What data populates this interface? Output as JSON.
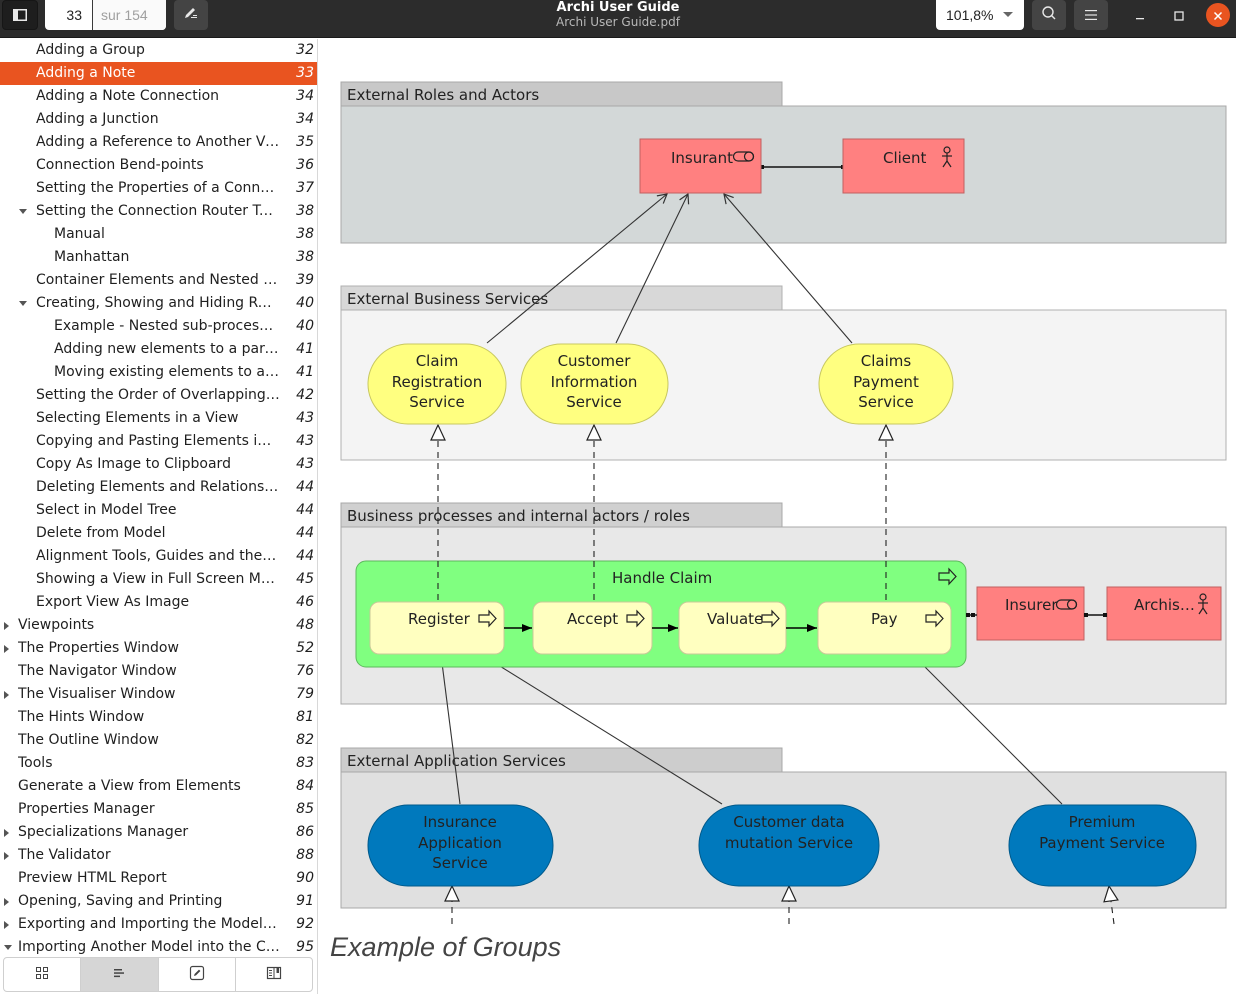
{
  "header": {
    "title": "Archi User Guide",
    "subtitle": "Archi User Guide.pdf",
    "current_page": "33",
    "total_pages": "sur 154",
    "zoom_level": "101,8%",
    "icons": {
      "sidebar_toggle": "sidebar-toggle-icon",
      "annotate": "pencil-icon",
      "search": "search-icon",
      "menu": "hamburger-menu-icon",
      "minimize": "minimize-icon",
      "maximize": "maximize-icon",
      "close": "close-icon"
    }
  },
  "sidebar": {
    "toc": [
      {
        "label": "Adding a Group",
        "page": "32",
        "level": 1,
        "expander": "none",
        "selected": false
      },
      {
        "label": "Adding a Note",
        "page": "33",
        "level": 1,
        "expander": "none",
        "selected": true
      },
      {
        "label": "Adding a Note Connection",
        "page": "34",
        "level": 1,
        "expander": "none",
        "selected": false
      },
      {
        "label": "Adding a Junction",
        "page": "34",
        "level": 1,
        "expander": "none",
        "selected": false
      },
      {
        "label": "Adding a Reference to Another View",
        "page": "35",
        "level": 1,
        "expander": "none",
        "selected": false
      },
      {
        "label": "Connection Bend-points",
        "page": "36",
        "level": 1,
        "expander": "none",
        "selected": false
      },
      {
        "label": "Setting the Properties of a Connec…",
        "page": "37",
        "level": 1,
        "expander": "none",
        "selected": false
      },
      {
        "label": "Setting the Connection Router Typ…",
        "page": "38",
        "level": 1,
        "expander": "open",
        "selected": false
      },
      {
        "label": "Manual",
        "page": "38",
        "level": 2,
        "expander": "none",
        "selected": false
      },
      {
        "label": "Manhattan",
        "page": "38",
        "level": 2,
        "expander": "none",
        "selected": false
      },
      {
        "label": "Container Elements and Nested El…",
        "page": "39",
        "level": 1,
        "expander": "none",
        "selected": false
      },
      {
        "label": "Creating, Showing and Hiding Relat…",
        "page": "40",
        "level": 1,
        "expander": "open",
        "selected": false
      },
      {
        "label": "Example - Nested sub-processe…",
        "page": "40",
        "level": 2,
        "expander": "none",
        "selected": false
      },
      {
        "label": "Adding new elements to a pare…",
        "page": "41",
        "level": 2,
        "expander": "none",
        "selected": false
      },
      {
        "label": "Moving existing elements to a p…",
        "page": "41",
        "level": 2,
        "expander": "none",
        "selected": false
      },
      {
        "label": "Setting the Order of Overlapping E…",
        "page": "42",
        "level": 1,
        "expander": "none",
        "selected": false
      },
      {
        "label": "Selecting Elements in a View",
        "page": "43",
        "level": 1,
        "expander": "none",
        "selected": false
      },
      {
        "label": "Copying and Pasting Elements in a …",
        "page": "43",
        "level": 1,
        "expander": "none",
        "selected": false
      },
      {
        "label": "Copy As Image to Clipboard",
        "page": "43",
        "level": 1,
        "expander": "none",
        "selected": false
      },
      {
        "label": "Deleting Elements and Relationshi…",
        "page": "44",
        "level": 1,
        "expander": "none",
        "selected": false
      },
      {
        "label": "Select in Model Tree",
        "page": "44",
        "level": 1,
        "expander": "none",
        "selected": false
      },
      {
        "label": "Delete from Model",
        "page": "44",
        "level": 1,
        "expander": "none",
        "selected": false
      },
      {
        "label": "Alignment Tools, Guides and the Grid",
        "page": "44",
        "level": 1,
        "expander": "none",
        "selected": false
      },
      {
        "label": "Showing a View in Full Screen Mode",
        "page": "45",
        "level": 1,
        "expander": "none",
        "selected": false
      },
      {
        "label": "Export View As Image",
        "page": "46",
        "level": 1,
        "expander": "none",
        "selected": false
      },
      {
        "label": "Viewpoints",
        "page": "48",
        "level": 0,
        "expander": "closed",
        "selected": false
      },
      {
        "label": "The Properties Window",
        "page": "52",
        "level": 0,
        "expander": "closed",
        "selected": false
      },
      {
        "label": "The Navigator Window",
        "page": "76",
        "level": 0,
        "expander": "none",
        "selected": false
      },
      {
        "label": "The Visualiser Window",
        "page": "79",
        "level": 0,
        "expander": "closed",
        "selected": false
      },
      {
        "label": "The Hints Window",
        "page": "81",
        "level": 0,
        "expander": "none",
        "selected": false
      },
      {
        "label": "The Outline Window",
        "page": "82",
        "level": 0,
        "expander": "none",
        "selected": false
      },
      {
        "label": "Tools",
        "page": "83",
        "level": 0,
        "expander": "none",
        "selected": false
      },
      {
        "label": "Generate a View from Elements",
        "page": "84",
        "level": 0,
        "expander": "none",
        "selected": false
      },
      {
        "label": "Properties Manager",
        "page": "85",
        "level": 0,
        "expander": "none",
        "selected": false
      },
      {
        "label": "Specializations Manager",
        "page": "86",
        "level": 0,
        "expander": "closed",
        "selected": false
      },
      {
        "label": "The Validator",
        "page": "88",
        "level": 0,
        "expander": "closed",
        "selected": false
      },
      {
        "label": "Preview HTML Report",
        "page": "90",
        "level": 0,
        "expander": "none",
        "selected": false
      },
      {
        "label": "Opening, Saving and Printing",
        "page": "91",
        "level": 0,
        "expander": "closed",
        "selected": false
      },
      {
        "label": "Exporting and Importing the Model i…",
        "page": "92",
        "level": 0,
        "expander": "closed",
        "selected": false
      },
      {
        "label": "Importing Another Model into the Cu…",
        "page": "95",
        "level": 0,
        "expander": "open",
        "selected": false
      }
    ],
    "tabs": [
      {
        "name": "thumbnails",
        "icon": "grid-icon",
        "active": false
      },
      {
        "name": "outline",
        "icon": "outline-list-icon",
        "active": true
      },
      {
        "name": "annotations",
        "icon": "annotation-icon",
        "active": false
      },
      {
        "name": "bookmarks",
        "icon": "bookmark-book-icon",
        "active": false
      }
    ]
  },
  "document": {
    "caption": "Example of Groups",
    "colors": {
      "accent": "#e95420",
      "actor_role": "#ff8080",
      "business_service": "#ffff80",
      "process_container": "#80ff80",
      "process_step": "#ffffc0",
      "application_service": "#0079bd"
    },
    "diagram": {
      "groups": [
        {
          "id": "g1",
          "label": "External Roles and Actors"
        },
        {
          "id": "g2",
          "label": "External Business Services"
        },
        {
          "id": "g3",
          "label": "Business processes and internal actors / roles"
        },
        {
          "id": "g4",
          "label": "External Application Services"
        }
      ],
      "elements": {
        "insurant": {
          "label": "Insurant",
          "type": "business-role"
        },
        "client": {
          "label": "Client",
          "type": "business-actor"
        },
        "claim_registration": {
          "label": "Claim\nRegistration\nService",
          "lines": [
            "Claim",
            "Registration",
            "Service"
          ],
          "type": "business-service"
        },
        "customer_information": {
          "label": "Customer\nInformation\nService",
          "lines": [
            "Customer",
            "Information",
            "Service"
          ],
          "type": "business-service"
        },
        "claims_payment": {
          "label": "Claims\nPayment\nService",
          "lines": [
            "Claims",
            "Payment",
            "Service"
          ],
          "type": "business-service"
        },
        "handle_claim": {
          "label": "Handle Claim",
          "type": "business-process"
        },
        "register": {
          "label": "Register",
          "type": "business-process"
        },
        "accept": {
          "label": "Accept",
          "type": "business-process"
        },
        "valuate": {
          "label": "Valuate",
          "type": "business-process"
        },
        "pay": {
          "label": "Pay",
          "type": "business-process"
        },
        "insurer": {
          "label": "Insurer",
          "type": "business-role"
        },
        "archisurance": {
          "label": "Archis…",
          "type": "business-actor"
        },
        "insurance_app": {
          "lines": [
            "Insurance",
            "Application",
            "Service"
          ],
          "type": "application-service"
        },
        "customer_data": {
          "lines": [
            "Customer data",
            "mutation Service"
          ],
          "type": "application-service"
        },
        "premium_payment": {
          "lines": [
            "Premium",
            "Payment Service"
          ],
          "type": "application-service"
        }
      }
    }
  }
}
